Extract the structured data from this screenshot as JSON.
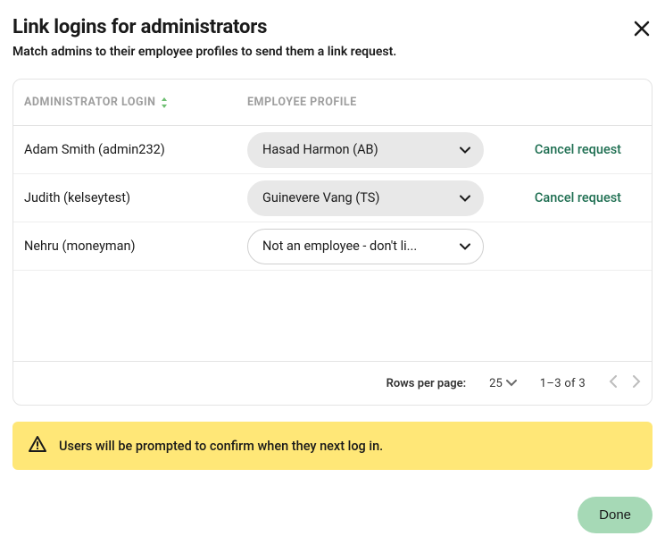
{
  "header": {
    "title": "Link logins for administrators",
    "subtitle": "Match admins to their employee profiles to send them a link request."
  },
  "table": {
    "columns": {
      "admin_login": "ADMINISTRATOR LOGIN",
      "employee_profile": "EMPLOYEE PROFILE"
    },
    "rows": [
      {
        "login": "Adam Smith (admin232)",
        "profile": "Hasad Harmon (AB)",
        "profile_filled": true,
        "action": "Cancel request"
      },
      {
        "login": "Judith (kelseytest)",
        "profile": "Guinevere Vang (TS)",
        "profile_filled": true,
        "action": "Cancel request"
      },
      {
        "login": "Nehru (moneyman)",
        "profile": "Not an employee - don't li...",
        "profile_filled": false,
        "action": ""
      }
    ]
  },
  "pager": {
    "rows_per_page_label": "Rows per page:",
    "rows_per_page_value": "25",
    "range": "1–3 of 3"
  },
  "banner": {
    "text": "Users will be prompted to confirm when they next log in."
  },
  "footer": {
    "done_label": "Done"
  }
}
